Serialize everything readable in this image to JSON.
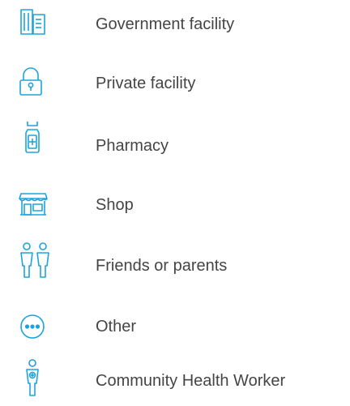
{
  "accent_color": "#1ca3dd",
  "text_color": "#454545",
  "items": [
    {
      "icon": "government-building-icon",
      "label": "Government facility"
    },
    {
      "icon": "padlock-icon",
      "label": "Private facility"
    },
    {
      "icon": "medicine-bottle-icon",
      "label": "Pharmacy"
    },
    {
      "icon": "storefront-icon",
      "label": "Shop"
    },
    {
      "icon": "two-people-icon",
      "label": "Friends or parents"
    },
    {
      "icon": "ellipsis-circle-icon",
      "label": "Other"
    },
    {
      "icon": "health-worker-icon",
      "label": "Community Health Worker"
    }
  ]
}
